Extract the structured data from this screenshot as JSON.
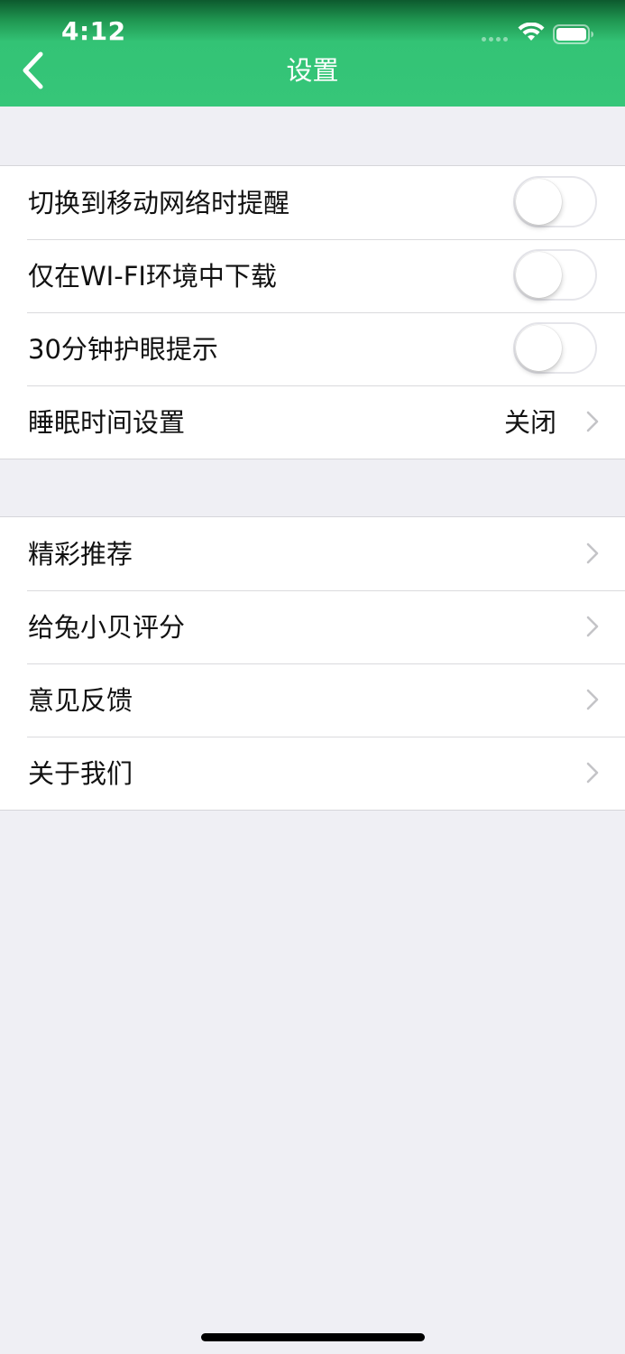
{
  "status_bar": {
    "time": "4:12",
    "wifi_icon": "wifi-icon",
    "battery_icon": "battery-icon"
  },
  "nav": {
    "title": "设置",
    "back_icon": "chevron-left-icon"
  },
  "colors": {
    "accent": "#36c679",
    "background": "#efeff4",
    "chevron": "#c4c4c7"
  },
  "settings_group": {
    "items": [
      {
        "label": "切换到移动网络时提醒",
        "control": "toggle",
        "on": false
      },
      {
        "label": "仅在WI-FI环境中下载",
        "control": "toggle",
        "on": false
      },
      {
        "label": "30分钟护眼提示",
        "control": "toggle",
        "on": false
      },
      {
        "label": "睡眠时间设置",
        "control": "disclosure",
        "value": "关闭"
      }
    ]
  },
  "more_group": {
    "items": [
      {
        "label": "精彩推荐",
        "control": "disclosure"
      },
      {
        "label": "给兔小贝评分",
        "control": "disclosure"
      },
      {
        "label": "意见反馈",
        "control": "disclosure"
      },
      {
        "label": "关于我们",
        "control": "disclosure"
      }
    ]
  }
}
